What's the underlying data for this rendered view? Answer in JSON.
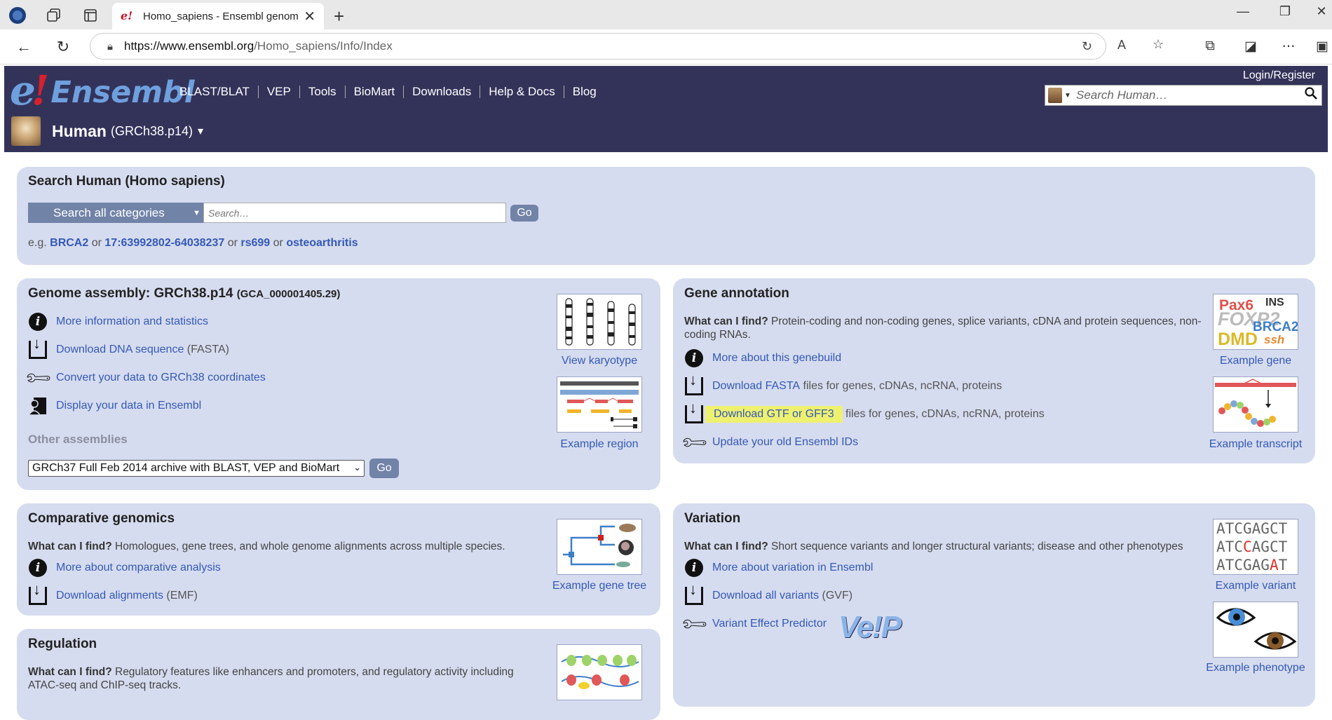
{
  "browser": {
    "tab_title": "Homo_sapiens - Ensembl genome",
    "url_host": "https://www.ensembl.org",
    "url_path": "/Homo_sapiens/Info/Index"
  },
  "header": {
    "logo_e": "e",
    "logo_bang": "!",
    "logo_word": "Ensembl",
    "nav": [
      "BLAST/BLAT",
      "VEP",
      "Tools",
      "BioMart",
      "Downloads",
      "Help & Docs",
      "Blog"
    ],
    "login": "Login/Register",
    "search_placeholder": "Search Human…",
    "species_name": "Human",
    "species_assembly": "(GRCh38.p14)",
    "species_caret": "▾"
  },
  "search_panel": {
    "title": "Search Human (Homo sapiens)",
    "category": "Search all categories",
    "placeholder": "Search…",
    "go": "Go",
    "eg_prefix": "e.g.",
    "examples": [
      "BRCA2",
      "17:63992802-64038237",
      "rs699",
      "osteoarthritis"
    ],
    "or": "or"
  },
  "genome_panel": {
    "title": "Genome assembly: GRCh38.p14",
    "accession": "(GCA_000001405.29)",
    "links": [
      {
        "icon": "info-icon",
        "text": "More information and statistics",
        "suffix": ""
      },
      {
        "icon": "download-icon",
        "text": "Download DNA sequence",
        "suffix": " (FASTA)"
      },
      {
        "icon": "wrench-icon",
        "text": "Convert your data to GRCh38 coordinates",
        "suffix": ""
      },
      {
        "icon": "user-data-icon",
        "text": "Display your data in Ensembl",
        "suffix": ""
      }
    ],
    "other_title": "Other assemblies",
    "other_select": "GRCh37 Full Feb 2014 archive with BLAST, VEP and BioMart",
    "other_go": "Go",
    "thumbs": [
      "View karyotype",
      "Example region"
    ]
  },
  "gene_panel": {
    "title": "Gene annotation",
    "find_label": "What can I find?",
    "find_text": " Protein-coding and non-coding genes, splice variants, cDNA and protein sequences, non-coding RNAs.",
    "links": [
      {
        "text": "More about this genebuild",
        "suffix": ""
      },
      {
        "text": "Download FASTA",
        "suffix": " files for genes, cDNAs, ncRNA, proteins"
      },
      {
        "text": "Download GTF or GFF3",
        "suffix": " files for genes, cDNAs, ncRNA, proteins"
      },
      {
        "text": "Update your old Ensembl IDs",
        "suffix": ""
      }
    ],
    "thumbs": [
      "Example gene",
      "Example transcript"
    ],
    "gene_words": [
      "Pax6",
      "INS",
      "FOXP2",
      "BRCA2",
      "DMD",
      "ssh"
    ]
  },
  "comparative_panel": {
    "title": "Comparative genomics",
    "find_label": "What can I find?",
    "find_text": " Homologues, gene trees, and whole genome alignments across multiple species.",
    "links": [
      {
        "text": "More about comparative analysis",
        "suffix": ""
      },
      {
        "text": "Download alignments",
        "suffix": " (EMF)"
      }
    ],
    "thumbs": [
      "Example gene tree"
    ]
  },
  "variation_panel": {
    "title": "Variation",
    "find_label": "What can I find?",
    "find_text": " Short sequence variants and longer structural variants; disease and other phenotypes",
    "links": [
      {
        "text": "More about variation in Ensembl",
        "suffix": ""
      },
      {
        "text": "Download all variants",
        "suffix": " (GVF)"
      },
      {
        "text": "Variant Effect Predictor",
        "suffix": ""
      }
    ],
    "vep_logo": "Ve!P",
    "seq_lines": [
      "ATCGAGCT",
      "ATCCAGCT",
      "ATCGAGAT"
    ],
    "thumbs": [
      "Example variant",
      "Example phenotype"
    ]
  },
  "regulation_panel": {
    "title": "Regulation",
    "find_label": "What can I find?",
    "find_text": " Regulatory features like enhancers and promoters, and regulatory activity including ATAC-seq and ChIP-seq tracks."
  }
}
